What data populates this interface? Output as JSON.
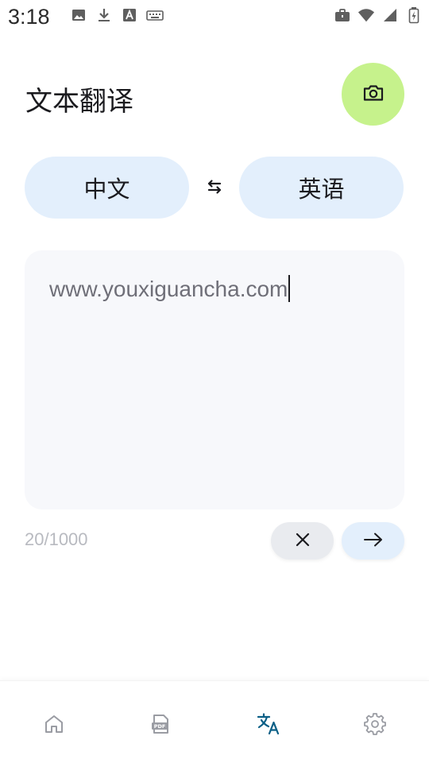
{
  "status_bar": {
    "time": "3:18",
    "left_icons": [
      "image-icon",
      "download-icon",
      "text-a-icon",
      "keyboard-icon"
    ],
    "right_icons": [
      "briefcase-icon",
      "wifi-icon",
      "signal-icon",
      "battery-icon"
    ]
  },
  "header": {
    "title": "文本翻译",
    "camera_icon": "camera-icon",
    "camera_color": "#c6f28c"
  },
  "languages": {
    "source": "中文",
    "target": "英语",
    "swap_icon": "swap-arrows-icon",
    "pill_color": "#e3effc"
  },
  "input": {
    "value": "www.youxiguancha.com",
    "char_count": "20/1000"
  },
  "actions": {
    "clear_icon": "close-icon",
    "translate_icon": "arrow-right-icon"
  },
  "bottom_nav": {
    "items": [
      {
        "icon": "home-icon",
        "active": false
      },
      {
        "icon": "pdf-icon",
        "active": false
      },
      {
        "icon": "translate-icon",
        "active": true
      },
      {
        "icon": "gear-icon",
        "active": false
      }
    ],
    "active_color": "#0b5f86",
    "inactive_color": "#9a9ca3"
  }
}
